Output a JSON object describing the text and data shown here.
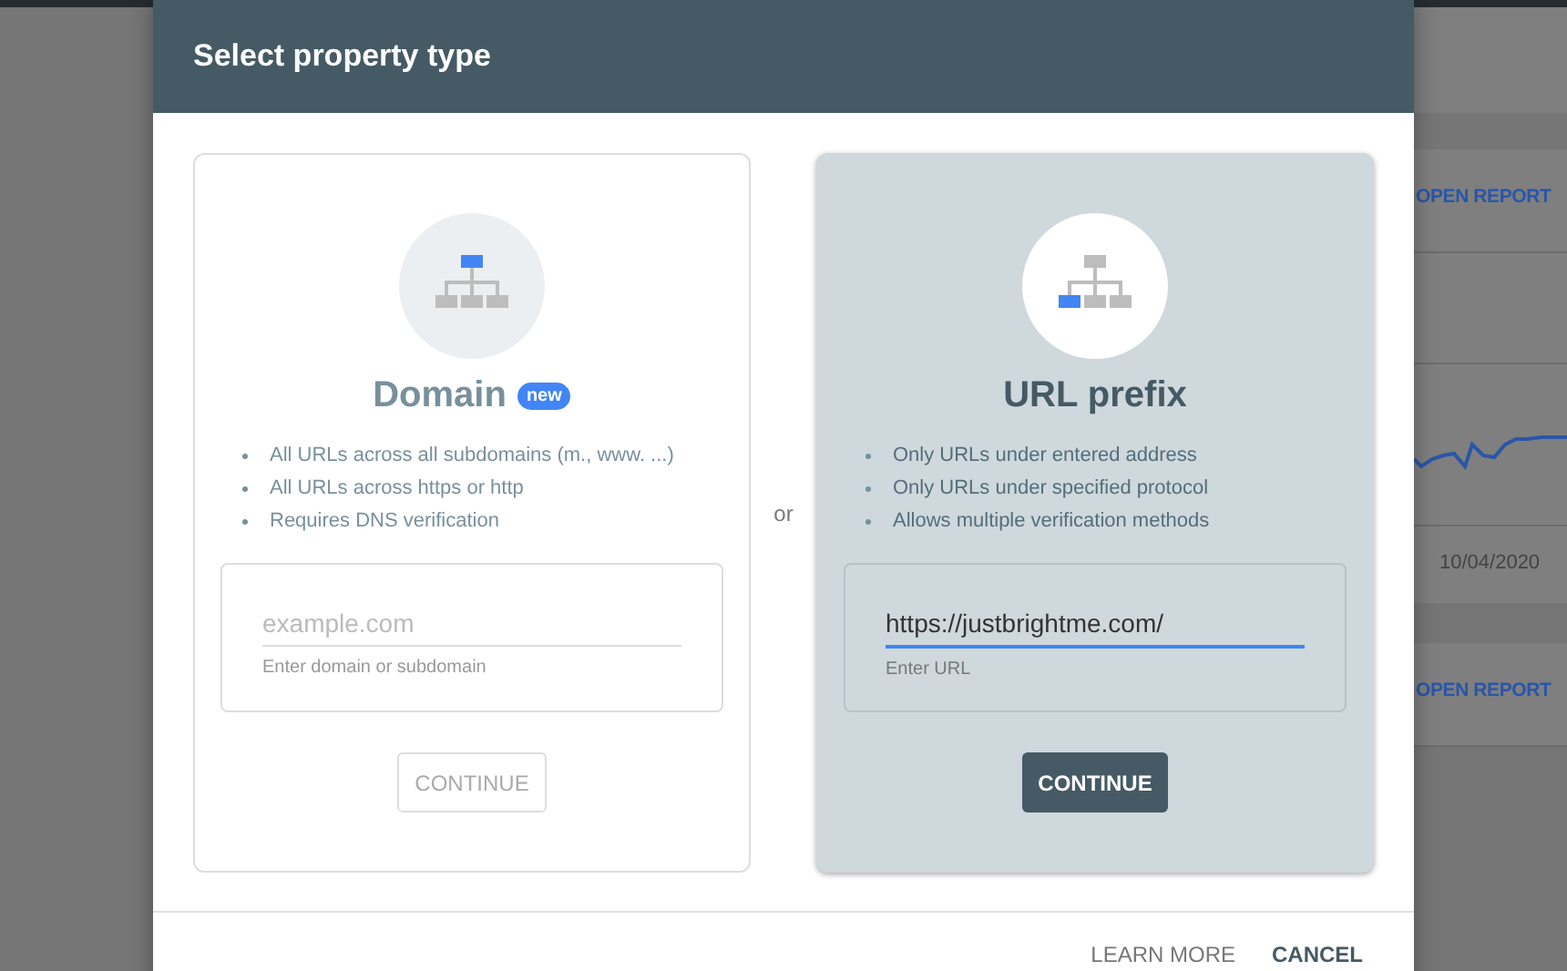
{
  "dialog": {
    "title": "Select property type",
    "separator": "or",
    "options": [
      {
        "kind": "domain",
        "title": "Domain",
        "badge": "new",
        "selected": false,
        "bullets": [
          "All URLs across all subdomains (m., www. ...)",
          "All URLs across https or http",
          "Requires DNS verification"
        ],
        "field": {
          "placeholder": "example.com",
          "focused": false,
          "helper": "Enter domain or subdomain"
        },
        "button": {
          "label": "CONTINUE",
          "disabled": true
        }
      },
      {
        "kind": "url_prefix",
        "title": "URL prefix",
        "selected": true,
        "bullets": [
          "Only URLs under entered address",
          "Only URLs under specified protocol",
          "Allows multiple verification methods"
        ],
        "field": {
          "value": "https://justbrightme.com/",
          "focused": true,
          "helper": "Enter URL"
        },
        "button": {
          "label": "CONTINUE",
          "disabled": false
        }
      }
    ],
    "footer_buttons": [
      "LEARN MORE",
      "CANCEL"
    ]
  },
  "background": {
    "links": [
      "OPEN REPORT",
      "OPEN REPORT"
    ],
    "date": "10/04/2020"
  }
}
